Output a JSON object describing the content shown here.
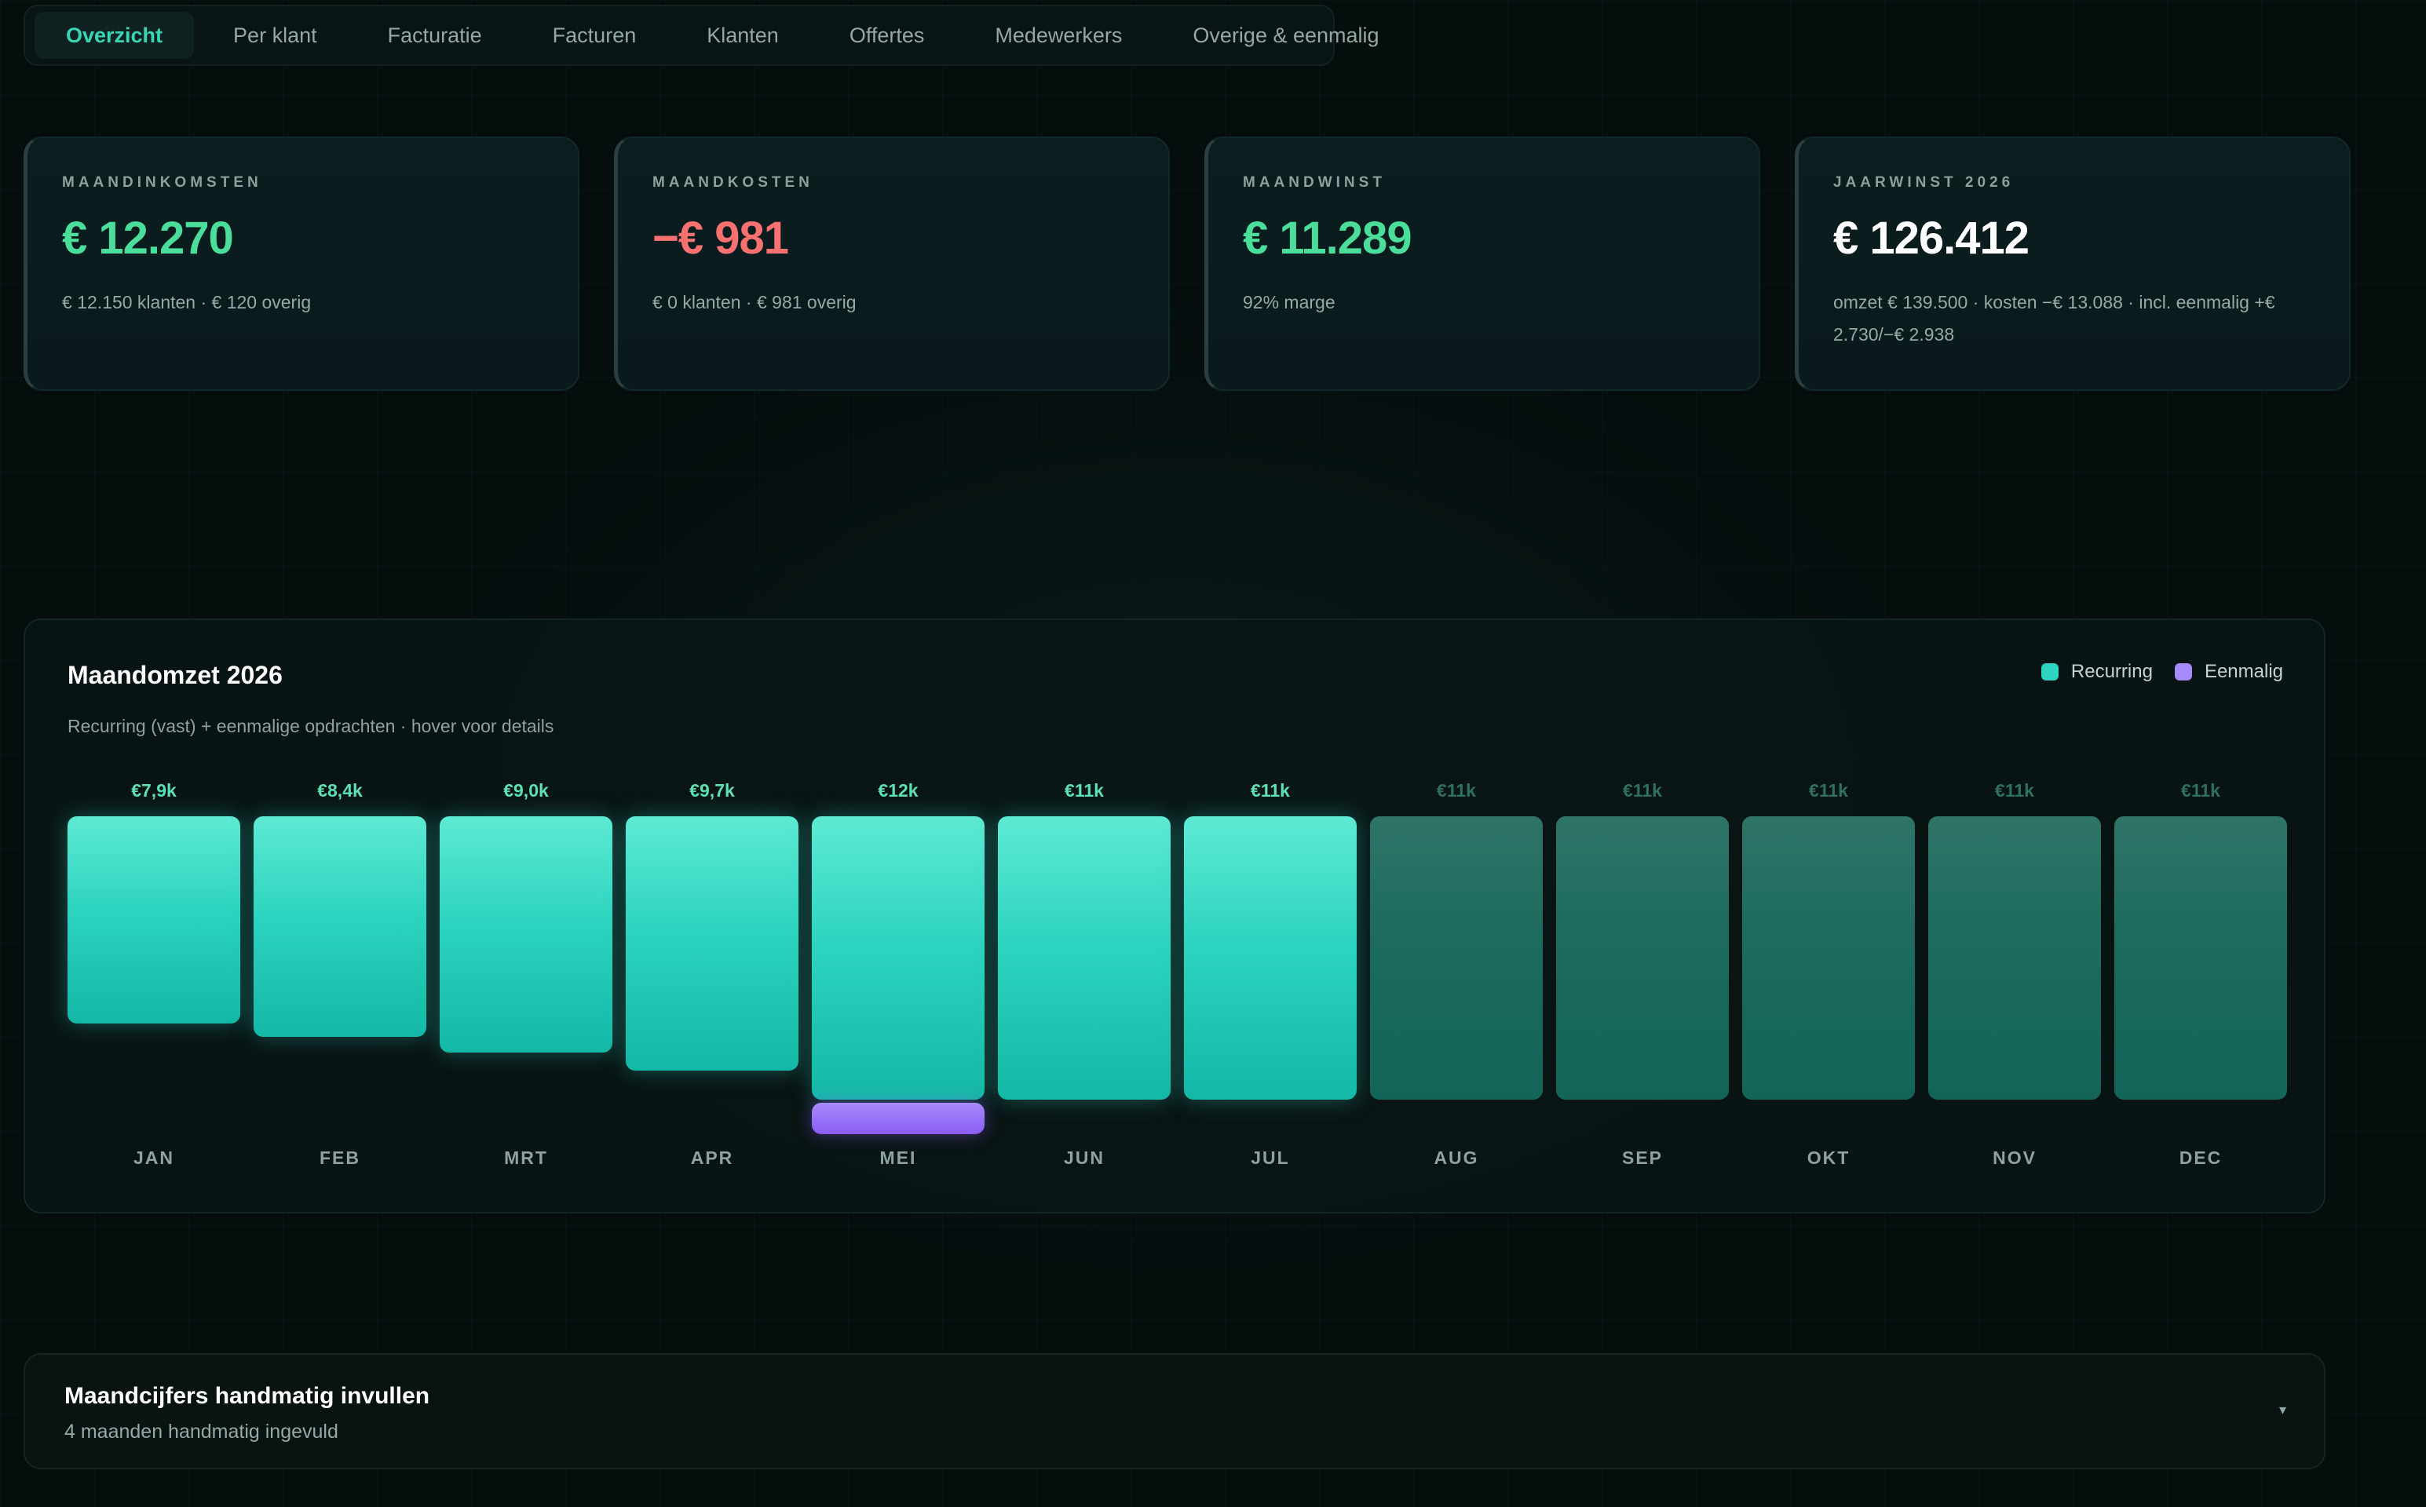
{
  "tabs": [
    {
      "label": "Overzicht",
      "active": true
    },
    {
      "label": "Per klant",
      "active": false
    },
    {
      "label": "Facturatie",
      "active": false
    },
    {
      "label": "Facturen",
      "active": false
    },
    {
      "label": "Klanten",
      "active": false
    },
    {
      "label": "Offertes",
      "active": false
    },
    {
      "label": "Medewerkers",
      "active": false
    },
    {
      "label": "Overige & eenmalig",
      "active": false
    }
  ],
  "kpis": [
    {
      "label": "MAANDINKOMSTEN",
      "value": "€ 12.270",
      "sub": "€ 12.150 klanten · € 120 overig",
      "color": "#4ade9a"
    },
    {
      "label": "MAANDKOSTEN",
      "value": "−€ 981",
      "sub": "€ 0 klanten · € 981 overig",
      "color": "#f87171"
    },
    {
      "label": "MAANDWINST",
      "value": "€ 11.289",
      "sub": "92% marge",
      "color": "#4ade9a"
    },
    {
      "label": "JAARWINST 2026",
      "value": "€ 126.412",
      "sub": "omzet € 139.500 · kosten −€ 13.088 · incl. eenmalig +€ 2.730/−€ 2.938",
      "color": "#ffffff"
    }
  ],
  "chart_data": {
    "type": "bar",
    "title": "Maandomzet 2026",
    "subtitle": "Recurring (vast) + eenmalige opdrachten · hover voor details",
    "categories": [
      "JAN",
      "FEB",
      "MRT",
      "APR",
      "MEI",
      "JUN",
      "JUL",
      "AUG",
      "SEP",
      "OKT",
      "NOV",
      "DEC"
    ],
    "value_labels": [
      "€7,9k",
      "€8,4k",
      "€9,0k",
      "€9,7k",
      "€12k",
      "€11k",
      "€11k",
      "€11k",
      "€11k",
      "€11k",
      "€11k",
      "€11k"
    ],
    "series": [
      {
        "name": "Recurring",
        "color": "#2dd4bf",
        "values": [
          7900,
          8400,
          9000,
          9700,
          10800,
          10800,
          10800,
          10800,
          10800,
          10800,
          10800,
          10800
        ]
      },
      {
        "name": "Eenmalig",
        "color": "#a78bfa",
        "values": [
          0,
          0,
          0,
          0,
          1200,
          0,
          0,
          0,
          0,
          0,
          0,
          0
        ]
      }
    ],
    "projected_from_index": 7,
    "ylim": [
      0,
      12000
    ]
  },
  "manual": {
    "title": "Maandcijfers handmatig invullen",
    "subtitle": "4 maanden handmatig ingevuld",
    "chevron": "▾"
  }
}
